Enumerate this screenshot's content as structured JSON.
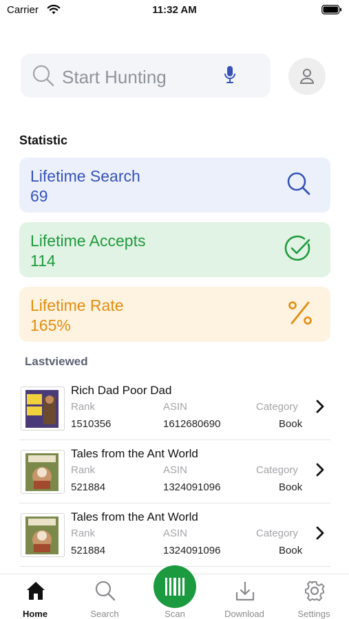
{
  "status_bar": {
    "carrier": "Carrier",
    "time": "11:32 AM"
  },
  "search": {
    "placeholder": "Start Hunting"
  },
  "statistic": {
    "title": "Statistic",
    "cards": [
      {
        "label": "Lifetime Search",
        "value": "69",
        "icon": "search-icon",
        "color": "#3552b8",
        "background": "#ecf0fb"
      },
      {
        "label": "Lifetime Accepts",
        "value": "114",
        "icon": "check-circle-icon",
        "color": "#1f9a3e",
        "background": "#e1f3e4"
      },
      {
        "label": "Lifetime Rate",
        "value": "165%",
        "icon": "percent-icon",
        "color": "#e38d10",
        "background": "#fdf3e0"
      }
    ]
  },
  "lastviewed": {
    "title": "Lastviewed",
    "labels": {
      "rank": "Rank",
      "asin": "ASIN",
      "category": "Category"
    },
    "items": [
      {
        "title": "Rich Dad Poor Dad",
        "rank": "1510356",
        "asin": "1612680690",
        "category": "Book"
      },
      {
        "title": "Tales from the Ant World",
        "rank": "521884",
        "asin": "1324091096",
        "category": "Book"
      },
      {
        "title": "Tales from the Ant World",
        "rank": "521884",
        "asin": "1324091096",
        "category": "Book"
      }
    ]
  },
  "tabs": [
    {
      "label": "Home",
      "icon": "home-icon",
      "active": true
    },
    {
      "label": "Search",
      "icon": "search-icon"
    },
    {
      "label": "Scan",
      "icon": "barcode-icon"
    },
    {
      "label": "Download",
      "icon": "download-icon"
    },
    {
      "label": "Settings",
      "icon": "gear-icon"
    }
  ],
  "accent_color": "#1c9a3f"
}
